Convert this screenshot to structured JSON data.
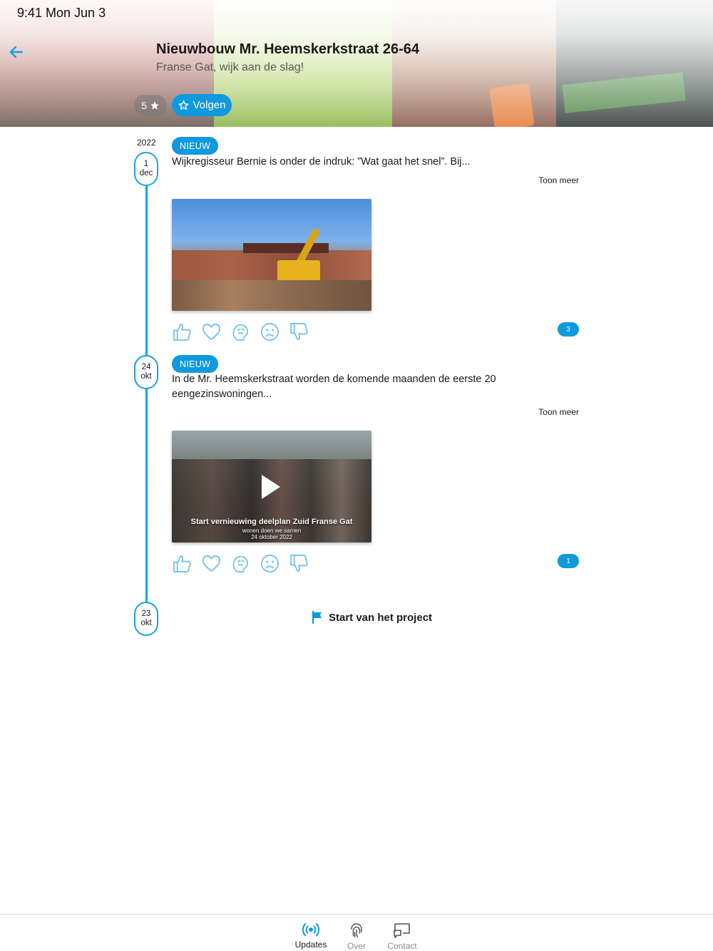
{
  "status_bar": {
    "time": "9:41  Mon Jun 3"
  },
  "header": {
    "title": "Nieuwbouw Mr. Heemskerkstraat 26-64",
    "subtitle": "Franse Gat, wijk aan de slag!",
    "follower_count": "5",
    "follow_label": "Volgen"
  },
  "timeline": {
    "year": "2022",
    "updates": [
      {
        "day": "1",
        "month": "dec",
        "badge": "NIEUW",
        "text": "Wijkregisseur Bernie is onder de indruk: ”Wat gaat het snel”. Bij...",
        "show_more": "Toon meer",
        "media_type": "photo",
        "reaction_count": "3"
      },
      {
        "day": "24",
        "month": "okt",
        "badge": "NIEUW",
        "text": "In de Mr. Heemskerkstraat worden de komende maanden de eerste 20 eengezinswoningen...",
        "show_more": "Toon meer",
        "media_type": "video",
        "video_caption": "Start vernieuwing deelplan Zuid Franse Gat",
        "video_subcaption": "wonen doen we samen",
        "video_date": "24 oktober 2022",
        "reaction_count": "1"
      }
    ],
    "start": {
      "day": "23",
      "month": "okt",
      "label": "Start van het project"
    }
  },
  "reactions": [
    "thumbs-up-icon",
    "heart-icon",
    "thinking-icon",
    "sad-face-icon",
    "thumbs-down-icon"
  ],
  "tabbar": {
    "tabs": [
      {
        "label": "Updates",
        "icon": "broadcast-icon",
        "active": true
      },
      {
        "label": "Over",
        "icon": "fingerprint-icon",
        "active": false
      },
      {
        "label": "Contact",
        "icon": "chat-screen-icon",
        "active": false
      }
    ]
  },
  "colors": {
    "accent": "#0f99de",
    "timeline": "#18a4e4",
    "reaction_icon": "#7cc3ec"
  }
}
